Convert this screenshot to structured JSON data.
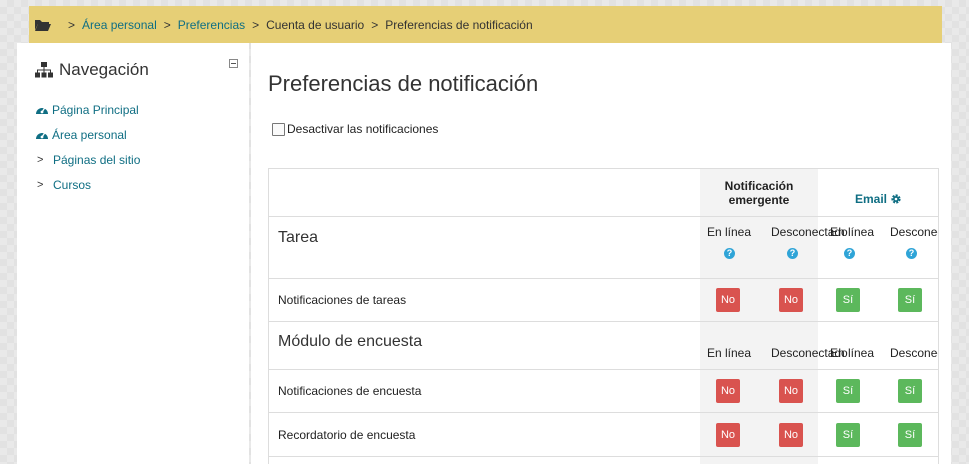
{
  "breadcrumb": {
    "items": [
      "Área personal",
      "Preferencias",
      "Cuenta de usuario",
      "Preferencias de notificación"
    ]
  },
  "nav": {
    "title": "Navegación",
    "items": [
      {
        "label": "Página Principal",
        "icon": "dashboard-icon"
      },
      {
        "label": "Área personal",
        "icon": "dashboard-icon"
      },
      {
        "label": "Páginas del sitio",
        "icon": "chevron-right-icon"
      },
      {
        "label": "Cursos",
        "icon": "chevron-right-icon"
      }
    ]
  },
  "main": {
    "title": "Preferencias de notificación",
    "disable_label": "Desactivar las notificaciones",
    "table": {
      "popup_header": "Notificación emergente",
      "email_header": "Email",
      "online_label": "En línea",
      "offline_label": "Desconectado",
      "help_glyph": "?",
      "sections": [
        {
          "title": "Tarea",
          "rows": [
            {
              "label": "Notificaciones de tareas",
              "values": [
                "No",
                "No",
                "Sí",
                "Sí"
              ]
            }
          ]
        },
        {
          "title": "Módulo de encuesta",
          "rows": [
            {
              "label": "Notificaciones de encuesta",
              "values": [
                "No",
                "No",
                "Sí",
                "Sí"
              ]
            },
            {
              "label": "Recordatorio de encuesta",
              "values": [
                "No",
                "No",
                "Sí",
                "Sí"
              ]
            }
          ]
        }
      ]
    }
  },
  "colors": {
    "breadcrumb_bg": "#e6cf76",
    "link": "#0f6e83",
    "no_button": "#d9534f",
    "yes_button": "#5cb85c",
    "help_icon": "#2fa4d7"
  }
}
